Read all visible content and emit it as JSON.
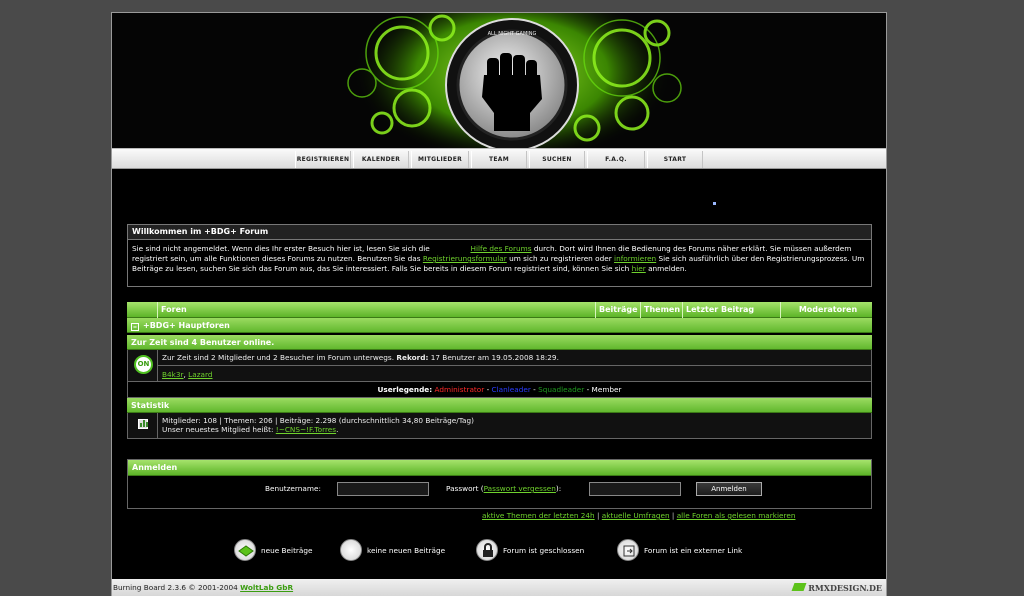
{
  "nav": [
    "REGISTRIEREN",
    "KALENDER",
    "MITGLIEDER",
    "TEAM",
    "SUCHEN",
    "F.A.Q.",
    "START"
  ],
  "welcome": {
    "title": "Willkommen im +BDG+ Forum",
    "t1": "Sie sind nicht angemeldet. Wenn dies Ihr erster Besuch hier ist, lesen Sie sich die",
    "link1": "Hilfe des Forums",
    "t2": "durch.  Dort wird Ihnen die Bedienung des Forums näher erklärt. Sie müssen außerdem registriert sein, um alle Funktionen dieses Forums zu nutzen. Benutzen Sie das",
    "link2": "Registrierungsformular",
    "t3": "um sich zu registrieren oder",
    "link3": "informieren",
    "t4": "Sie sich ausführlich über den Registrierungsprozess. Um Beiträge zu lesen, suchen Sie sich das Forum aus, das Sie interessiert. Falls Sie bereits in diesem Forum registriert sind, können Sie sich",
    "link4": "hier",
    "t5": "anmelden."
  },
  "columns": {
    "forum": "Foren",
    "posts": "Beiträge",
    "topics": "Themen",
    "last": "Letzter Beitrag",
    "mods": "Moderatoren"
  },
  "category": "+BDG+ Hauptforen",
  "online": {
    "title": "Zur Zeit sind 4 Benutzer online.",
    "icon_label": "ON",
    "line1": "Zur Zeit sind 2 Mitglieder und 2 Besucher im Forum unterwegs.",
    "record_label": "Rekord:",
    "record_text": "17 Benutzer am 19.05.2008 18:29.",
    "user1": "B4k3r",
    "user2": "Lazard"
  },
  "userlegend": {
    "label": "Userlegende:",
    "admin": "Administrator",
    "clan": "Clanleader",
    "squad": "Squadleader",
    "member": "Member",
    "colors": {
      "admin": "#ff2a2a",
      "clan": "#2a3cff",
      "squad": "#1f9a1f",
      "member": "#ffffff"
    }
  },
  "stats": {
    "title": "Statistik",
    "line1": "Mitglieder: 108 | Themen: 206 | Beiträge: 2.298 (durchschnittlich 34,80 Beiträge/Tag)",
    "line2": "Unser neuestes Mitglied heißt:",
    "newest": "!~CNS~!F.Torres"
  },
  "login": {
    "title": "Anmelden",
    "user_label": "Benutzername:",
    "pass_label": "Passwort (",
    "pass_link": "Passwort vergessen",
    "pass_end": "):",
    "button": "Anmelden"
  },
  "quicklinks": [
    "aktive Themen der letzten 24h",
    "aktuelle Umfragen",
    "alle Foren als gelesen markieren"
  ],
  "icon_legend": [
    "neue Beiträge",
    "keine neuen Beiträge",
    "Forum ist geschlossen",
    "Forum ist ein externer Link"
  ],
  "footer": {
    "text": "Burning Board 2.3.6 © 2001-2004",
    "company": "WoltLab GbR",
    "credit": "RMXDESIGN.DE"
  },
  "colors": {
    "accent": "#6fd22d",
    "bar": "#7fcb45"
  }
}
